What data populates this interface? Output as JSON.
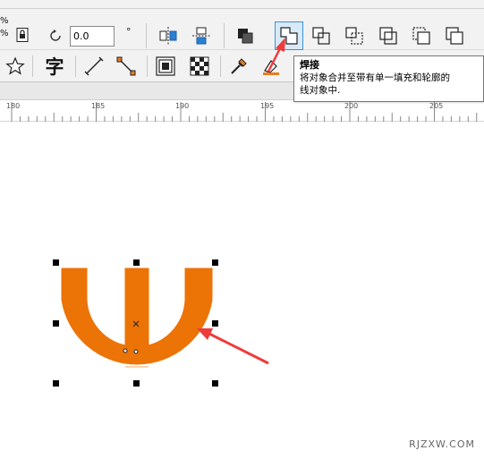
{
  "toolbar": {
    "percent_top": "%",
    "percent_bottom": "%",
    "rotation_value": "0.0",
    "degree_symbol": "°",
    "text_tool_glyph": "字",
    "icons_row1": [
      "lock-icon",
      "rotate-icon",
      "mirror-horizontal-icon",
      "mirror-vertical-icon",
      "arrange-order-icon",
      "weld-icon",
      "trim-icon",
      "intersect-icon",
      "simplify-icon",
      "front-minus-back-icon",
      "back-minus-front-icon"
    ],
    "icons_row2": [
      "star-icon",
      "text-tool-icon",
      "dimension-tool-icon",
      "connector-tool-icon",
      "contour-icon",
      "transparency-icon",
      "eyedropper-icon",
      "interactive-fill-icon"
    ]
  },
  "tooltip": {
    "title": "焊接",
    "line1": "将对象合并至带有单一填充和轮廓的",
    "line2": "线对象中."
  },
  "ruler": {
    "labels": [
      "180",
      "185",
      "190",
      "195",
      "200",
      "205"
    ]
  },
  "canvas": {
    "shape_color": "#ec7306",
    "arrow_color": "#ee3b3b",
    "selection_handle_color": "#000000"
  },
  "watermark": "RJZXW.COM"
}
